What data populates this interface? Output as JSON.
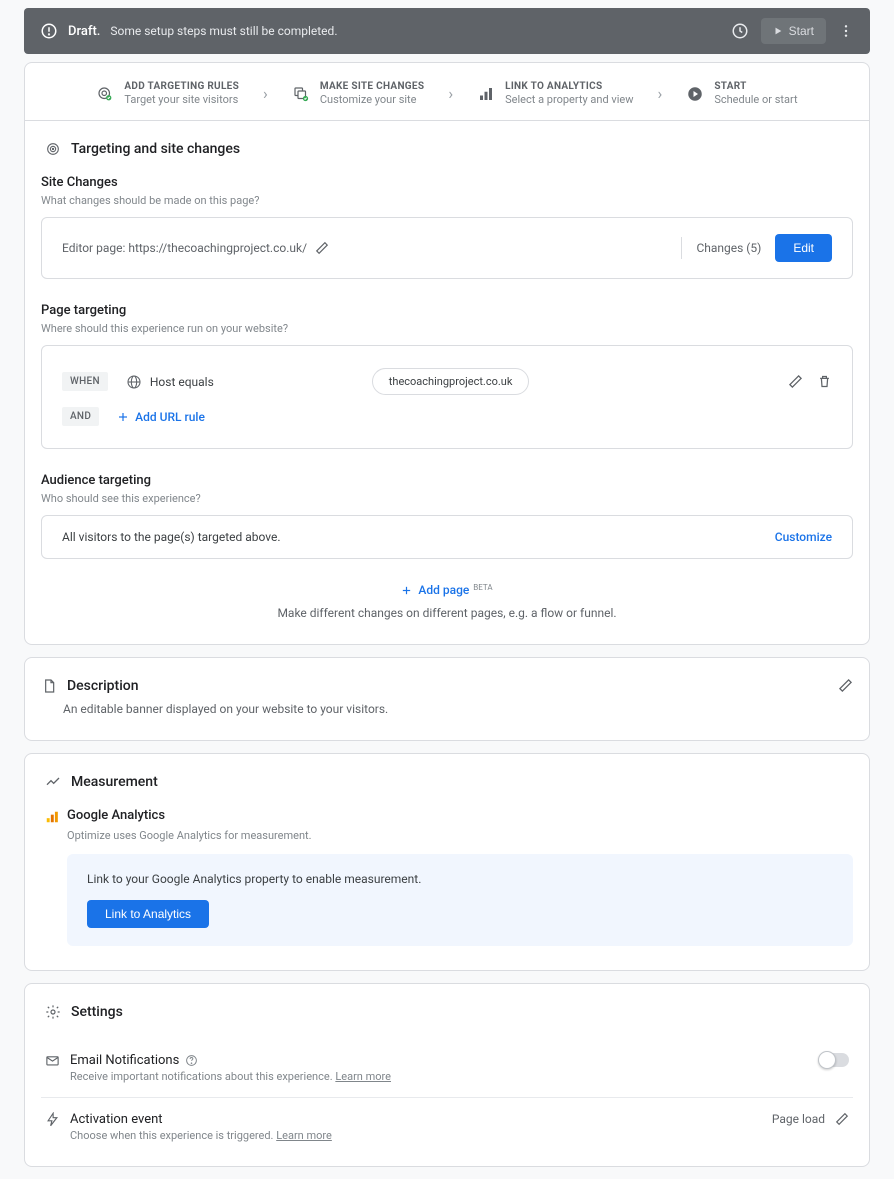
{
  "banner": {
    "status": "Draft.",
    "message": "Some setup steps must still be completed.",
    "start_label": "Start"
  },
  "stepper": {
    "steps": [
      {
        "title": "ADD TARGETING RULES",
        "subtitle": "Target your site visitors"
      },
      {
        "title": "MAKE SITE CHANGES",
        "subtitle": "Customize your site"
      },
      {
        "title": "LINK TO ANALYTICS",
        "subtitle": "Select a property and view"
      },
      {
        "title": "START",
        "subtitle": "Schedule or start"
      }
    ]
  },
  "targeting": {
    "title": "Targeting and site changes",
    "site_changes": {
      "heading": "Site Changes",
      "desc": "What changes should be made on this page?",
      "editor_label": "Editor page: https://thecoachingproject.co.uk/",
      "changes_label": "Changes (5)",
      "edit_label": "Edit"
    },
    "page_targeting": {
      "heading": "Page targeting",
      "desc": "Where should this experience run on your website?",
      "when_chip": "WHEN",
      "rule_label": "Host equals",
      "rule_value": "thecoachingproject.co.uk",
      "and_chip": "AND",
      "add_rule": "Add URL rule"
    },
    "audience": {
      "heading": "Audience targeting",
      "desc": "Who should see this experience?",
      "value": "All visitors to the page(s) targeted above.",
      "customize": "Customize"
    },
    "add_page": {
      "label": "Add page",
      "beta": "BETA",
      "desc": "Make different changes on different pages, e.g. a flow or funnel."
    }
  },
  "description": {
    "title": "Description",
    "text": "An editable banner displayed on your website to your visitors."
  },
  "measurement": {
    "title": "Measurement",
    "ga_title": "Google Analytics",
    "ga_desc": "Optimize uses Google Analytics for measurement.",
    "info_text": "Link to your Google Analytics property to enable measurement.",
    "link_button": "Link to Analytics"
  },
  "settings": {
    "title": "Settings",
    "email": {
      "title": "Email Notifications",
      "desc": "Receive important notifications about this experience.",
      "learn_more": "Learn more"
    },
    "activation": {
      "title": "Activation event",
      "desc": "Choose when this experience is triggered.",
      "learn_more": "Learn more",
      "value": "Page load"
    }
  }
}
